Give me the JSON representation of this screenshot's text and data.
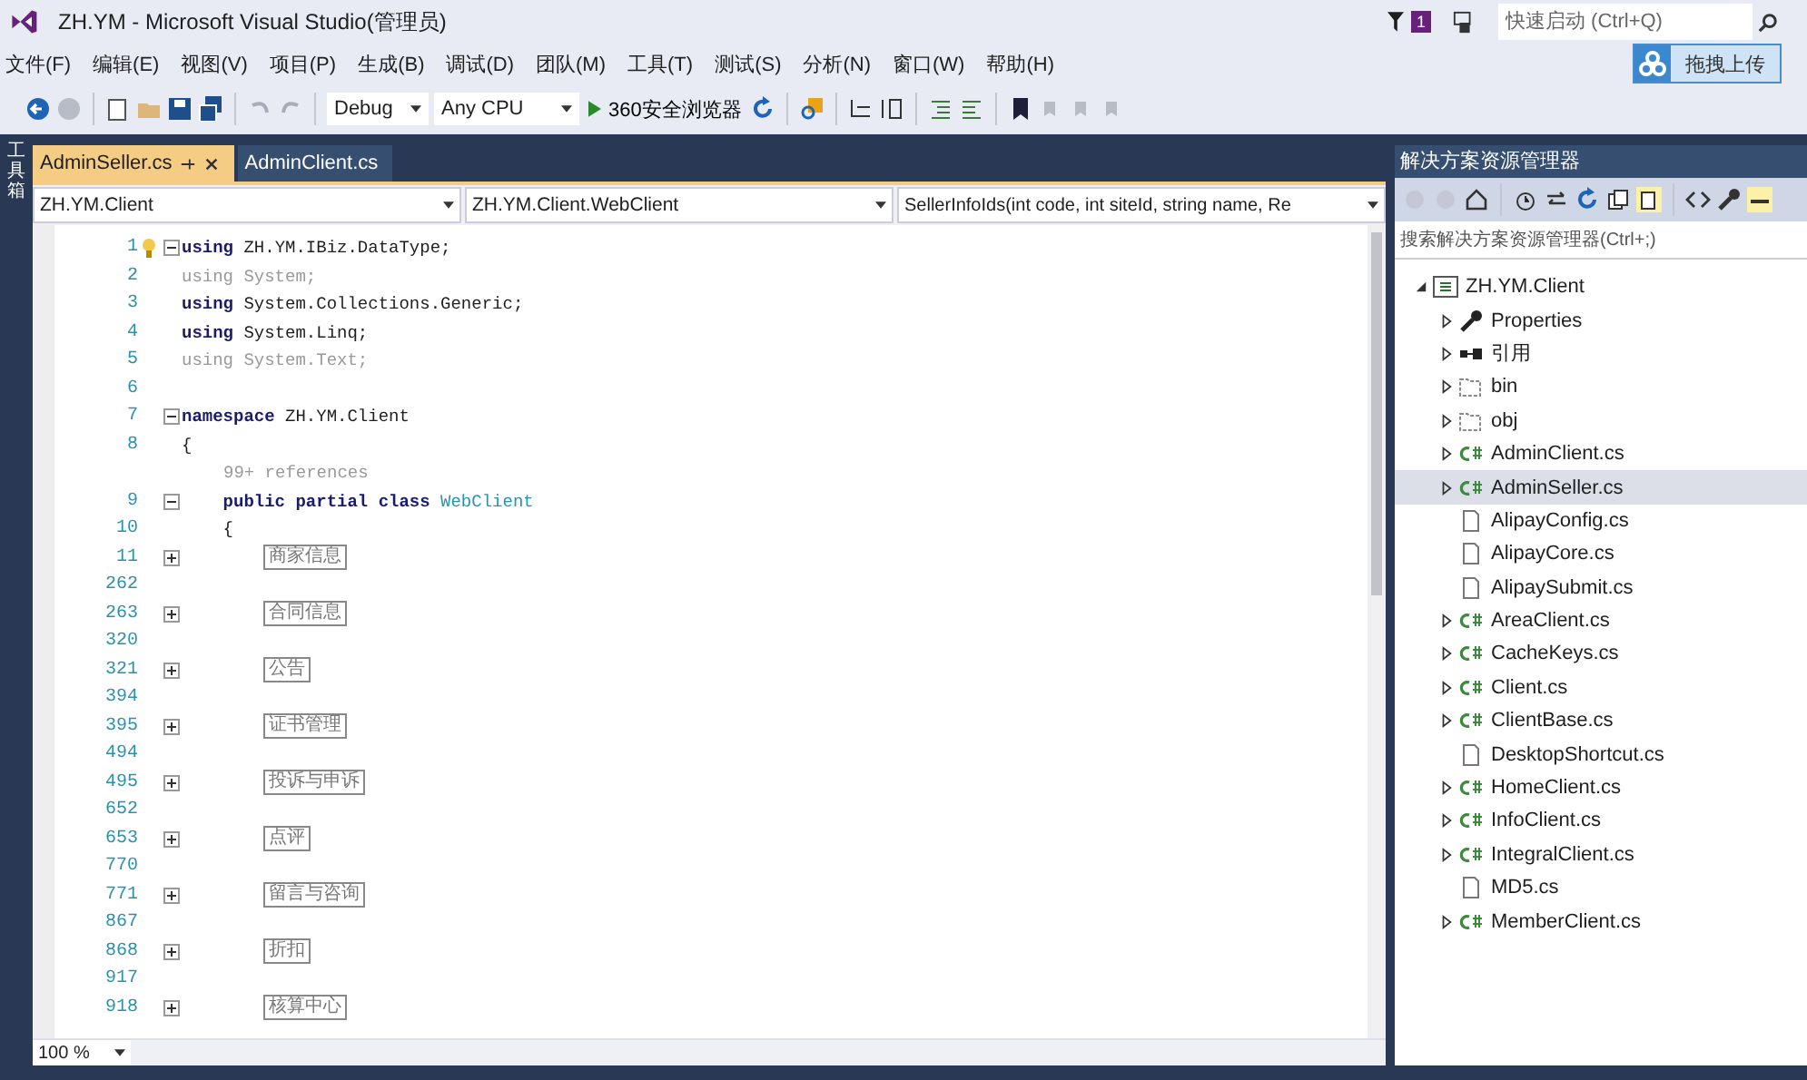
{
  "window": {
    "title": "ZH.YM - Microsoft Visual Studio(管理员)",
    "notification_count": "1",
    "quick_launch": {
      "placeholder": "快速启动 (Ctrl+Q)"
    },
    "upload_button": "拖拽上传"
  },
  "menu": [
    "文件(F)",
    "编辑(E)",
    "视图(V)",
    "项目(P)",
    "生成(B)",
    "调试(D)",
    "团队(M)",
    "工具(T)",
    "测试(S)",
    "分析(N)",
    "窗口(W)",
    "帮助(H)"
  ],
  "toolbar": {
    "configuration": "Debug",
    "platform": "Any CPU",
    "run_target": "360安全浏览器"
  },
  "toolbox_tab": "工具箱",
  "editor": {
    "tabs": [
      {
        "label": "AdminSeller.cs",
        "selected": true
      },
      {
        "label": "AdminClient.cs",
        "selected": false
      }
    ],
    "nav": [
      "ZH.YM.Client",
      "ZH.YM.Client.WebClient",
      "SellerInfoIds(int code, int siteId, string name, Re"
    ],
    "lines": [
      {
        "number": "1",
        "kind": "block",
        "tokens": [
          {
            "t": "using",
            "kind": "keyword"
          },
          {
            "t": " ZH.YM.IBiz.DataType;",
            "kind": "plain"
          }
        ]
      },
      {
        "number": "2",
        "kind": "code",
        "tokens": [
          {
            "t": "using System;",
            "kind": "unused"
          }
        ]
      },
      {
        "number": "3",
        "kind": "code",
        "tokens": [
          {
            "t": "using",
            "kind": "keyword"
          },
          {
            "t": " System.Collections.Generic;",
            "kind": "plain"
          }
        ]
      },
      {
        "number": "4",
        "kind": "code",
        "tokens": [
          {
            "t": "using",
            "kind": "keyword"
          },
          {
            "t": " System.Linq;",
            "kind": "plain"
          }
        ]
      },
      {
        "number": "5",
        "kind": "code",
        "tokens": [
          {
            "t": "using System.Text;",
            "kind": "unused"
          }
        ]
      },
      {
        "number": "6",
        "kind": "blank"
      },
      {
        "number": "7",
        "kind": "block",
        "tokens": [
          {
            "t": "namespace",
            "kind": "keyword"
          },
          {
            "t": " ZH.YM.Client",
            "kind": "plain"
          }
        ]
      },
      {
        "number": "8",
        "kind": "code",
        "tokens": [
          {
            "t": "{",
            "kind": "plain"
          }
        ]
      },
      {
        "kind": "lens",
        "text": "99+ references"
      },
      {
        "number": "9",
        "kind": "block",
        "tokens": [
          {
            "t": "    public partial class ",
            "kind": "keyword"
          },
          {
            "t": "WebClient",
            "kind": "type"
          }
        ]
      },
      {
        "number": "10",
        "kind": "code",
        "tokens": [
          {
            "t": "    {",
            "kind": "plain"
          }
        ]
      },
      {
        "number": "11",
        "kind": "region",
        "label": "商家信息"
      },
      {
        "number": "262",
        "kind": "blank"
      },
      {
        "number": "263",
        "kind": "region",
        "label": "合同信息"
      },
      {
        "number": "320",
        "kind": "blank"
      },
      {
        "number": "321",
        "kind": "region",
        "label": "公告"
      },
      {
        "number": "394",
        "kind": "blank"
      },
      {
        "number": "395",
        "kind": "region",
        "label": "证书管理"
      },
      {
        "number": "494",
        "kind": "blank"
      },
      {
        "number": "495",
        "kind": "region",
        "label": "投诉与申诉"
      },
      {
        "number": "652",
        "kind": "blank"
      },
      {
        "number": "653",
        "kind": "region",
        "label": "点评"
      },
      {
        "number": "770",
        "kind": "blank"
      },
      {
        "number": "771",
        "kind": "region",
        "label": "留言与咨询"
      },
      {
        "number": "867",
        "kind": "blank"
      },
      {
        "number": "868",
        "kind": "region",
        "label": "折扣"
      },
      {
        "number": "917",
        "kind": "blank"
      },
      {
        "number": "918",
        "kind": "region",
        "label": "核算中心"
      }
    ],
    "zoom": "100 %"
  },
  "solution_explorer": {
    "title": "解决方案资源管理器",
    "search": {
      "placeholder": "搜索解决方案资源管理器(Ctrl+;)"
    },
    "tree": [
      {
        "label": "ZH.YM.Client",
        "kind": "project",
        "expanded": true,
        "selected": false,
        "children": [
          {
            "label": "Properties",
            "kind": "properties",
            "expanded": false,
            "selected": false
          },
          {
            "label": "引用",
            "kind": "references",
            "expanded": false,
            "selected": false
          },
          {
            "label": "bin",
            "kind": "folder",
            "expanded": false,
            "selected": false
          },
          {
            "label": "obj",
            "kind": "folder",
            "expanded": false,
            "selected": false
          },
          {
            "label": "AdminClient.cs",
            "kind": "csharp",
            "expanded": false,
            "selected": false
          },
          {
            "label": "AdminSeller.cs",
            "kind": "csharp",
            "expanded": false,
            "selected": true
          },
          {
            "label": "AlipayConfig.cs",
            "kind": "file",
            "expanded": false,
            "selected": false
          },
          {
            "label": "AlipayCore.cs",
            "kind": "file",
            "expanded": false,
            "selected": false
          },
          {
            "label": "AlipaySubmit.cs",
            "kind": "file",
            "expanded": false,
            "selected": false
          },
          {
            "label": "AreaClient.cs",
            "kind": "csharp",
            "expanded": false,
            "selected": false
          },
          {
            "label": "CacheKeys.cs",
            "kind": "csharp",
            "expanded": false,
            "selected": false
          },
          {
            "label": "Client.cs",
            "kind": "csharp",
            "expanded": false,
            "selected": false
          },
          {
            "label": "ClientBase.cs",
            "kind": "csharp",
            "expanded": false,
            "selected": false
          },
          {
            "label": "DesktopShortcut.cs",
            "kind": "file",
            "expanded": false,
            "selected": false
          },
          {
            "label": "HomeClient.cs",
            "kind": "csharp",
            "expanded": false,
            "selected": false
          },
          {
            "label": "InfoClient.cs",
            "kind": "csharp",
            "expanded": false,
            "selected": false
          },
          {
            "label": "IntegralClient.cs",
            "kind": "csharp",
            "expanded": false,
            "selected": false
          },
          {
            "label": "MD5.cs",
            "kind": "file",
            "expanded": false,
            "selected": false
          },
          {
            "label": "MemberClient.cs",
            "kind": "csharp",
            "expanded": false,
            "selected": false
          }
        ]
      }
    ]
  }
}
